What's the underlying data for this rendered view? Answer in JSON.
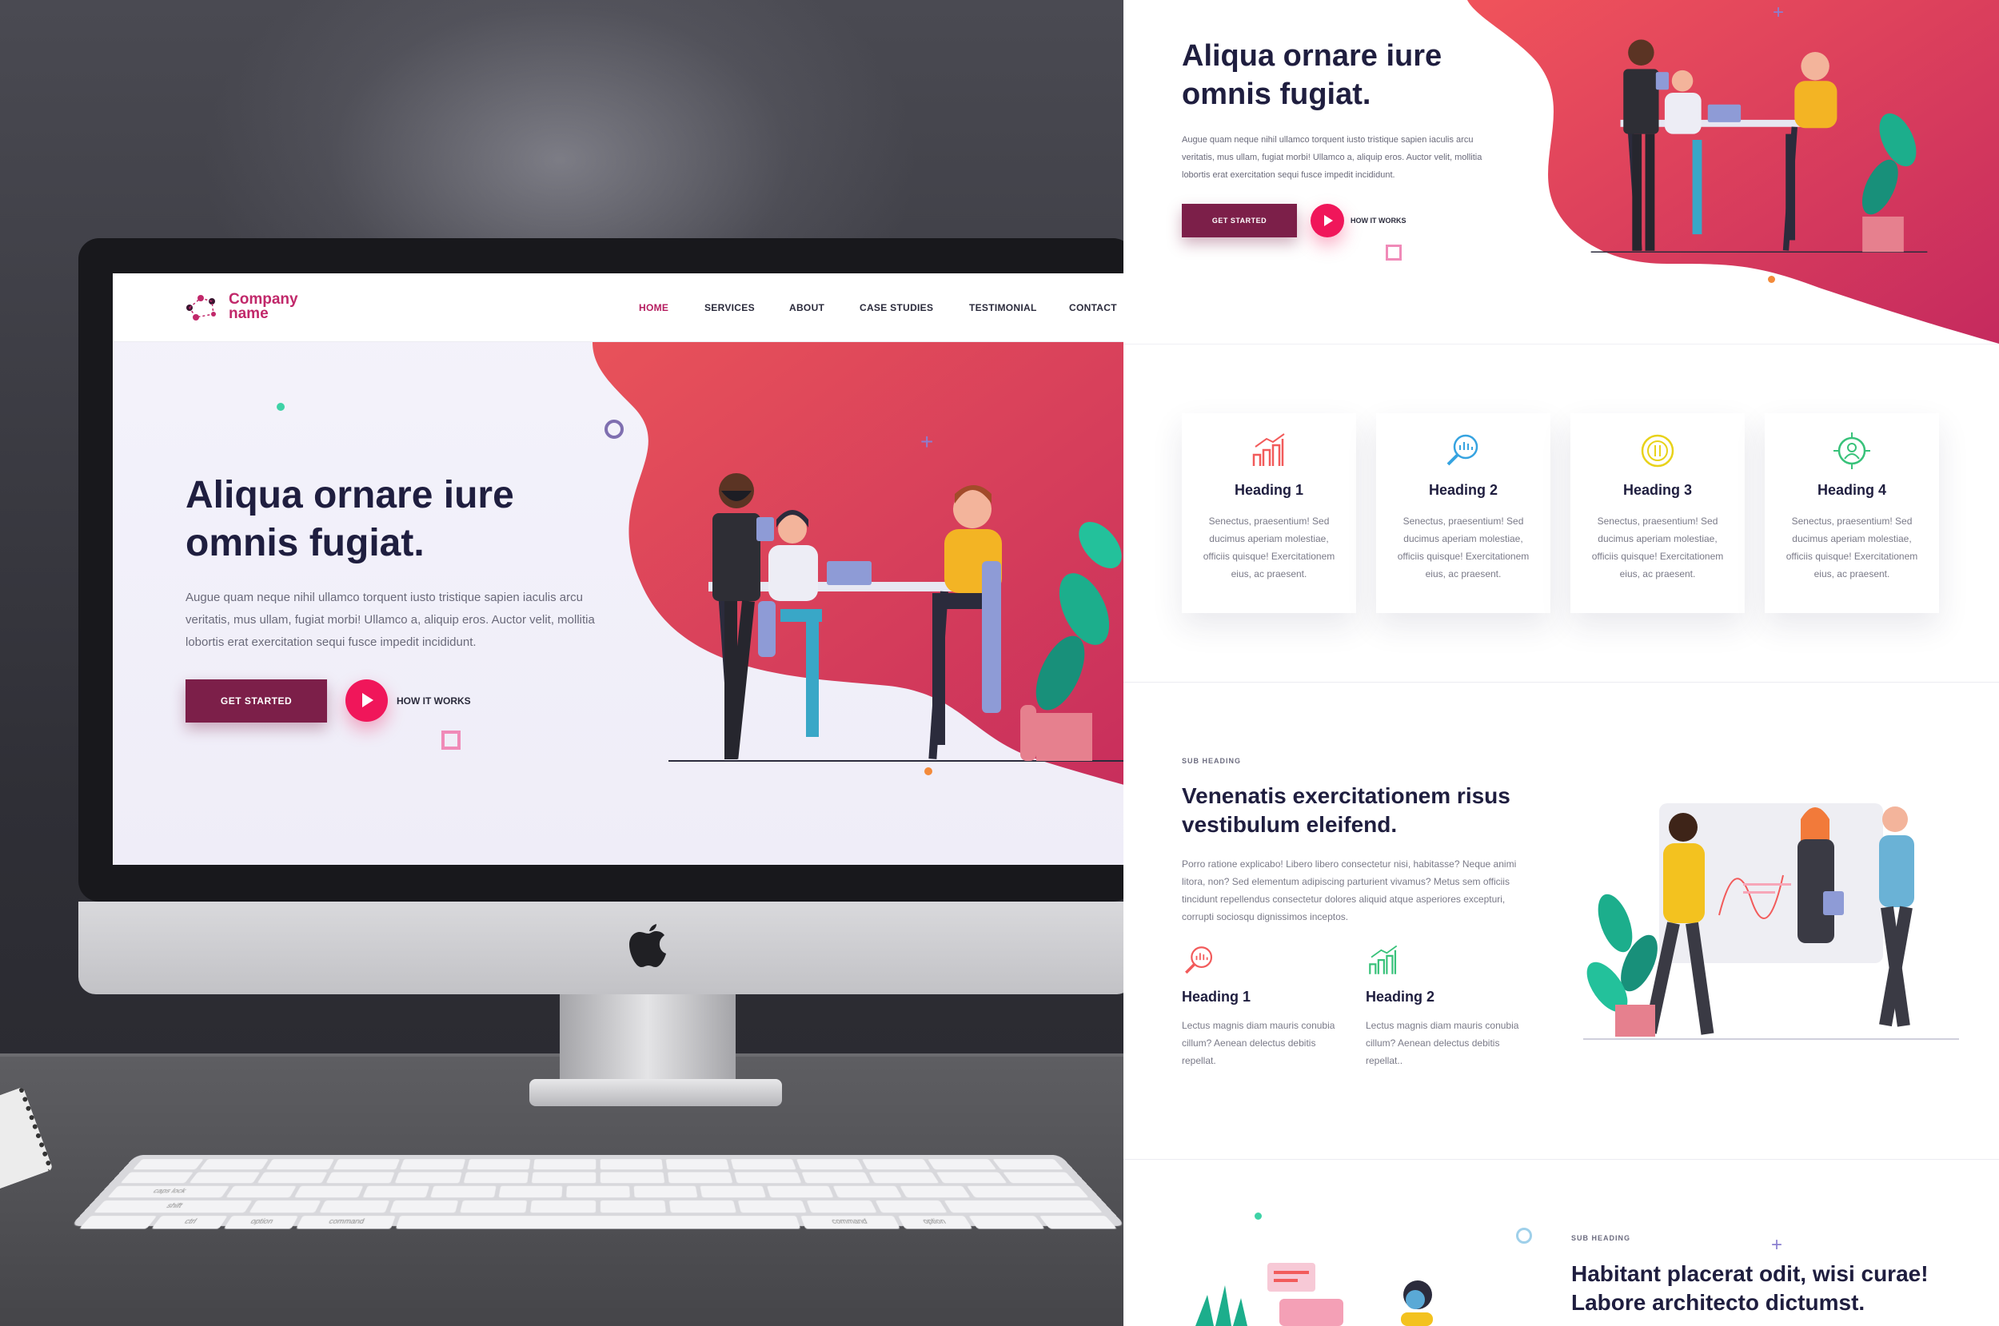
{
  "brand": {
    "name": "Company name",
    "accent": "#c1286a",
    "button": "#7c1f49",
    "play": "#f0165a",
    "heading": "#1f1e3f"
  },
  "nav": {
    "items": [
      "HOME",
      "SERVICES",
      "ABOUT",
      "CASE STUDIES",
      "TESTIMONIAL",
      "CONTACT"
    ],
    "active": "HOME"
  },
  "hero": {
    "title_line1": "Aliqua ornare iure",
    "title_line2": "omnis fugiat.",
    "text_line1": "Augue quam neque nihil ullamco torquent iusto tristique sapien iaculis arcu",
    "text_line2": "veritatis, mus ullam, fugiat morbi! Ullamco a, aliquip eros. Auctor velit, mollitia",
    "text_line3": "lobortis erat exercitation sequi fusce impedit incididunt.",
    "cta": "GET STARTED",
    "secondary": "HOW IT WORKS"
  },
  "cards": [
    {
      "title": "Heading 1",
      "icon": "bar-chart-icon",
      "color": "#f25b5b",
      "text": [
        "Senectus, praesentium! Sed",
        "ducimus aperiam molestiae,",
        "officiis quisque! Exercitationem",
        "eius, ac praesent."
      ]
    },
    {
      "title": "Heading 2",
      "icon": "magnifier-icon",
      "color": "#36a3e0",
      "text": [
        "Senectus, praesentium! Sed",
        "ducimus aperiam molestiae,",
        "officiis quisque! Exercitationem",
        "eius, ac praesent."
      ]
    },
    {
      "title": "Heading 3",
      "icon": "coin-icon",
      "color": "#e8d21a",
      "text": [
        "Senectus, praesentium! Sed",
        "ducimus aperiam molestiae,",
        "officiis quisque! Exercitationem",
        "eius, ac praesent."
      ]
    },
    {
      "title": "Heading 4",
      "icon": "target-user-icon",
      "color": "#38c27a",
      "text": [
        "Senectus, praesentium! Sed",
        "ducimus aperiam molestiae,",
        "officiis quisque! Exercitationem",
        "eius, ac praesent."
      ]
    }
  ],
  "section2": {
    "sub_heading": "SUB HEADING",
    "title_line1": "Venenatis exercitationem risus",
    "title_line2": "vestibulum eleifend.",
    "text": [
      "Porro ratione explicabo! Libero libero consectetur nisi, habitasse? Neque animi",
      "litora, non? Sed elementum adipiscing parturient vivamus? Metus sem officiis",
      "tincidunt repellendus consectetur dolores aliquid atque asperiores excepturi,",
      "corrupti sociosqu dignissimos inceptos."
    ],
    "features": [
      {
        "title": "Heading 1",
        "icon": "magnifier-icon",
        "color": "#f25b5b",
        "text": [
          "Lectus magnis diam mauris conubia",
          "cillum? Aenean delectus debitis",
          "repellat."
        ]
      },
      {
        "title": "Heading 2",
        "icon": "bar-chart-icon",
        "color": "#38c27a",
        "text": [
          "Lectus magnis diam mauris conubia",
          "cillum? Aenean delectus debitis",
          "repellat.."
        ]
      }
    ]
  },
  "section3": {
    "sub_heading": "SUB HEADING",
    "title_line1": "Habitant placerat odit, wisi curae!",
    "title_line2": "Labore architecto dictumst."
  },
  "keyboard": {
    "labels": [
      "caps lock",
      "shift",
      "ctrl",
      "option",
      "command",
      "command",
      "option"
    ]
  }
}
